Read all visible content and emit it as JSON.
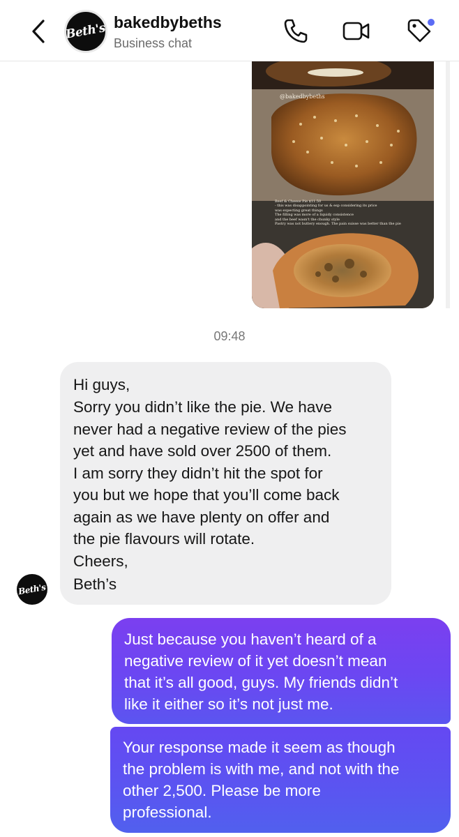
{
  "header": {
    "account_name": "bakedbybeths",
    "subtitle": "Business chat",
    "avatar_logo_text": "Beth's",
    "icons": {
      "back": "chevron-left-icon",
      "call": "phone-icon",
      "video": "video-camera-icon",
      "tag": "price-tag-icon"
    },
    "tag_badge_color": "#5b6cf5"
  },
  "shared_image": {
    "description_icon": "food-photo",
    "watermark": "@bakedbybeths",
    "caption_lines": [
      "Beef & Cheese Pie $11.50",
      "- this was disappointing for us & esp considering its price",
      "was expecting great things",
      "The filling was more of a liquidy consistence",
      "and the beef wasn't the chunky style",
      "Pastry was not buttery enough. The pain suisse was better than the pie"
    ]
  },
  "timestamp": "09:48",
  "incoming_message": {
    "avatar_logo_text": "Beth's",
    "paragraphs": [
      [
        "Hi guys,"
      ],
      [
        "Sorry you didn’t like the pie. We have",
        "never had a negative review of the pies",
        "yet and have sold over 2500 of them."
      ],
      [
        "I am sorry they didn’t hit the spot for",
        "you but we hope that you’ll come back",
        "again as we have plenty on offer and",
        "the pie flavours will rotate."
      ],
      [
        "Cheers,"
      ],
      [
        "Beth’s"
      ]
    ]
  },
  "outgoing_messages": [
    [
      "Just because you haven’t heard of a",
      "negative review of it yet doesn’t mean",
      "that it’s all good, guys. My friends didn’t",
      "like it either so it’s not just me."
    ],
    [
      "Your response made it seem as though",
      "the problem is with me, and not with the",
      "other 2,500. Please be more",
      "professional."
    ]
  ],
  "colors": {
    "incoming_bubble": "#efeff0",
    "outgoing_bubble_top": "#7b3ff0",
    "outgoing_bubble_bottom": "#5160ee"
  }
}
